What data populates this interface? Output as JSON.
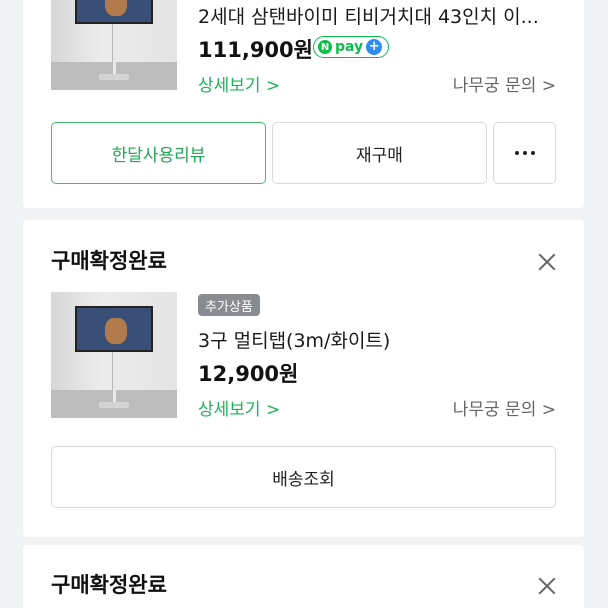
{
  "order1": {
    "product_title": "2세대 삼탠바이미 티비거치대 43인치 이...",
    "price": "111,900원",
    "npay_label": "pay",
    "npay_n": "N",
    "npay_plus": "+",
    "detail_link": "상세보기 >",
    "inquiry_link": "나무궁 문의 >",
    "buttons": [
      "한달사용리뷰",
      "재구매"
    ],
    "more_icon": "more-horizontal-icon"
  },
  "order2": {
    "status": "구매확정완료",
    "tag": "추가상품",
    "product_title": "3구 멀티탭(3m/화이트)",
    "price": "12,900원",
    "detail_link": "상세보기 >",
    "inquiry_link": "나무궁 문의 >",
    "button": "배송조회"
  },
  "order3": {
    "status": "구매확정완료"
  },
  "colors": {
    "accent_green": "#1fb35b",
    "npay_green": "#0bbf4b",
    "background": "#f2f3f5"
  }
}
